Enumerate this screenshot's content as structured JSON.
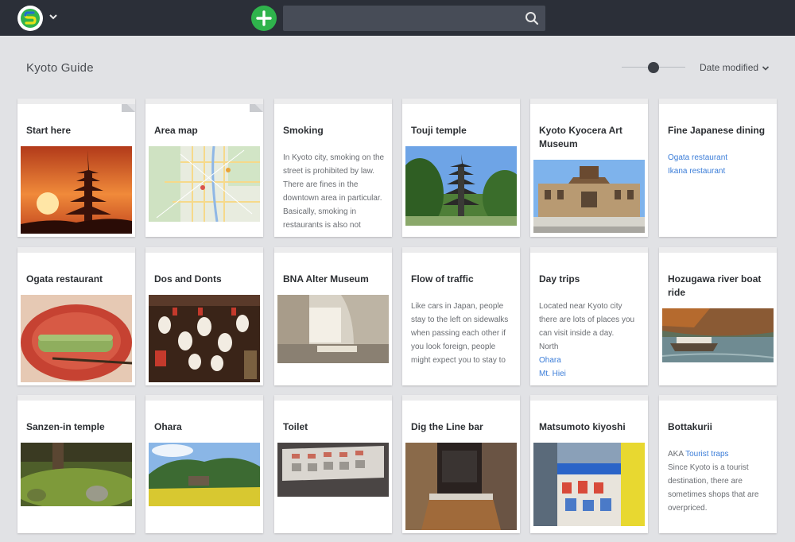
{
  "app": {
    "logo_icon": "app-logo-icon",
    "accent": "#2fb34c"
  },
  "search": {
    "placeholder": ""
  },
  "page": {
    "title": "Kyoto Guide",
    "sort_label": "Date modified"
  },
  "colors": {
    "link": "#3b7dd8",
    "topbar": "#2b2f38",
    "background": "#e1e2e5"
  },
  "cards": [
    {
      "title": "Start here"
    },
    {
      "title": "Area map"
    },
    {
      "title": "Smoking",
      "text": "In Kyoto city, smoking on the street is prohibited by law. There are fines in the downtown area in particular. Basically, smoking in restaurants is also not"
    },
    {
      "title": "Touji temple"
    },
    {
      "title": "Kyoto Kyocera Art Museum"
    },
    {
      "title": "Fine Japanese dining",
      "links": [
        "Ogata restaurant",
        "Ikana restaurant"
      ]
    },
    {
      "title": "Ogata restaurant"
    },
    {
      "title": "Dos and Donts"
    },
    {
      "title": "BNA Alter Museum"
    },
    {
      "title": "Flow of traffic",
      "text": "Like cars in Japan, people stay to the left on sidewalks when passing each other if you look foreign, people might expect you to stay to"
    },
    {
      "title": "Day trips",
      "text": "Located near Kyoto city there are lots of places you can visit inside a day.",
      "line": "North",
      "links": [
        "Ohara",
        "Mt. Hiei"
      ]
    },
    {
      "title": "Hozugawa river boat ride"
    },
    {
      "title": "Sanzen-in temple"
    },
    {
      "title": "Ohara"
    },
    {
      "title": "Toilet"
    },
    {
      "title": "Dig the Line bar"
    },
    {
      "title": "Matsumoto kiyoshi"
    },
    {
      "title": "Bottakurii",
      "aka_prefix": "AKA",
      "aka_link": "Tourist traps",
      "text": "Since Kyoto is a tourist destination, there are sometimes shops that are overpriced."
    }
  ]
}
